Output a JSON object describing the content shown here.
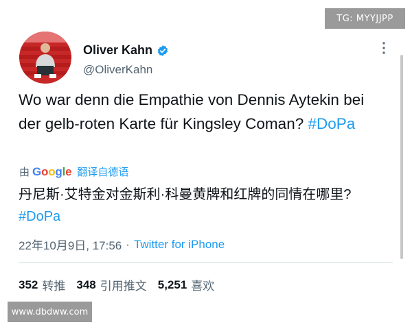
{
  "watermarks": {
    "top_right": "TG: MYYJJPP",
    "bottom_left": "www.dbdww.com"
  },
  "author": {
    "name": "Oliver Kahn",
    "handle": "@OliverKahn",
    "verified_icon": "verified-badge-icon",
    "avatar_icon": "profile-photo"
  },
  "tweet": {
    "text": "Wo war denn die Empathie von Dennis Aytekin bei der gelb-roten Karte für Kingsley Coman?",
    "hashtag": "#DoPa"
  },
  "translation": {
    "by_label": "由",
    "provider": "Google",
    "action_label": "翻译自德语",
    "text": "丹尼斯·艾特金对金斯利·科曼黄牌和红牌的同情在哪里?",
    "hashtag": "#DoPa"
  },
  "meta": {
    "timestamp": "22年10月9日, 17:56",
    "separator": "·",
    "source": "Twitter for iPhone"
  },
  "stats": [
    {
      "count": "352",
      "label": "转推"
    },
    {
      "count": "348",
      "label": "引用推文"
    },
    {
      "count": "5,251",
      "label": "喜欢"
    }
  ],
  "colors": {
    "accent": "#1d9bf0",
    "text": "#0f1419",
    "secondary": "#536471"
  }
}
